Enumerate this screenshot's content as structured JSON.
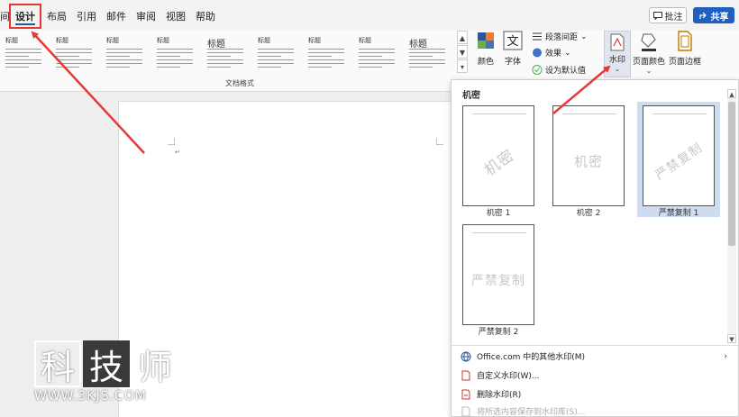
{
  "tabs": [
    {
      "label": "间",
      "active": false
    },
    {
      "label": "设计",
      "active": true
    },
    {
      "label": "布局",
      "active": false
    },
    {
      "label": "引用",
      "active": false
    },
    {
      "label": "邮件",
      "active": false
    },
    {
      "label": "审阅",
      "active": false
    },
    {
      "label": "视图",
      "active": false
    },
    {
      "label": "帮助",
      "active": false
    }
  ],
  "header": {
    "comment_label": "批注",
    "share_label": "共享"
  },
  "ribbon": {
    "style_titles": [
      "标题",
      "标题",
      "标题",
      "标题",
      "标题",
      "标题",
      "标题",
      "标题",
      "标题"
    ],
    "gallery_group_label": "文档格式",
    "colors_label": "颜色",
    "fonts_label": "字体",
    "paragraph_spacing_label": "段落间距",
    "effects_label": "效果",
    "set_default_label": "设为默认值",
    "watermark_label": "水印",
    "page_color_label": "页面颜色",
    "page_borders_label": "页面边框",
    "accent_color": "#2b579a"
  },
  "watermark_panel": {
    "section_title": "机密",
    "items": [
      {
        "caption": "机密 1",
        "text": "机密",
        "selected": false
      },
      {
        "caption": "机密 2",
        "text": "机密",
        "selected": false
      },
      {
        "caption": "严禁复制 1",
        "text": "严禁复制",
        "selected": true
      },
      {
        "caption": "严禁复制 2",
        "text": "严禁复制",
        "selected": false
      }
    ],
    "menu": [
      {
        "label": "Office.com 中的其他水印(M)",
        "icon": "globe-icon",
        "disabled": false
      },
      {
        "label": "自定义水印(W)...",
        "icon": "document-icon",
        "disabled": false
      },
      {
        "label": "删除水印(R)",
        "icon": "document-remove-icon",
        "disabled": false
      },
      {
        "label": "将所选内容保存到水印库(S)...",
        "icon": "document-save-icon",
        "disabled": true
      }
    ]
  },
  "logo": {
    "chars": [
      "科",
      "技",
      "师"
    ],
    "url": "WWW.3KJS.COM"
  },
  "annotation_color": "#e53935"
}
